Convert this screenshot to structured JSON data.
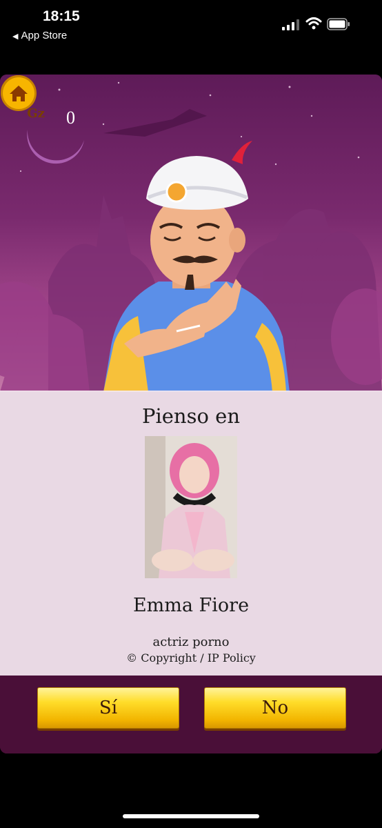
{
  "status_bar": {
    "time": "18:15",
    "back_label": "App Store",
    "back_icon": "triangle-left",
    "icons": [
      "signal-icon",
      "wifi-icon",
      "battery-icon"
    ]
  },
  "game": {
    "coin_label": "Gz",
    "coin_count": "0",
    "home_icon": "home-icon"
  },
  "result": {
    "heading": "Pienso en",
    "character_name": "Emma Fiore",
    "character_description": "actriz porno",
    "copyright": "© Copyright / IP Policy"
  },
  "buttons": {
    "yes_label": "Sí",
    "no_label": "No"
  },
  "colors": {
    "background": "#5e1b58",
    "panel": "#f4e8f0",
    "bottom_bar": "#4a0f38",
    "button": "#ffdd2a",
    "coin": "#f5b400"
  }
}
